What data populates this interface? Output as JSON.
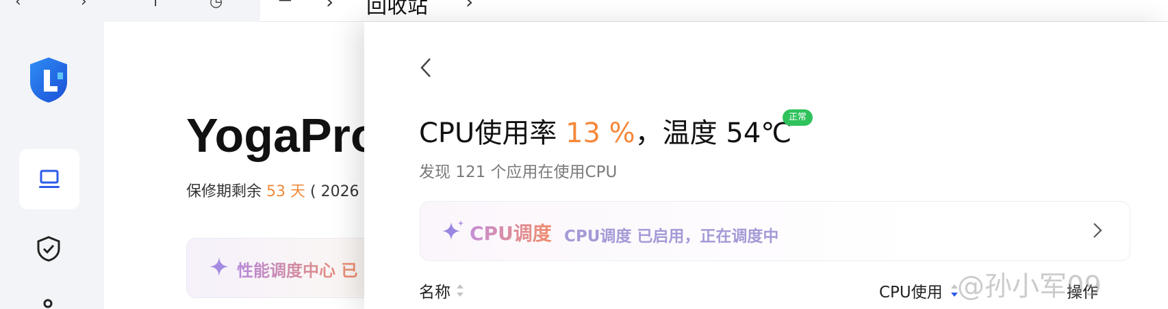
{
  "topbar": {
    "back": "‹",
    "forward": "›",
    "pin": "↑",
    "clock": "◷",
    "crumb_sep": "›",
    "crumb": "回收站",
    "crumb_end": "›"
  },
  "device": {
    "name": "YogaPro",
    "warranty_prefix": "保修期剩余 ",
    "warranty_days": "53 天",
    "warranty_suffix": " ( 2026",
    "perf_label": "性能调度中心 已"
  },
  "panel": {
    "title_prefix": "CPU使用率 ",
    "cpu_usage": "13 %",
    "title_mid": "，温度 54℃",
    "status_badge": "正常",
    "subtitle": "发现 121 个应用在使用CPU",
    "schedule_title": "CPU调度",
    "schedule_desc": "CPU调度 已启用，正在调度中"
  },
  "table": {
    "headers": [
      "名称",
      "CPU使用",
      "操作"
    ]
  },
  "watermark": "@孙小军09",
  "colors": {
    "accent_orange": "#f5883a",
    "status_green": "#2fc25b",
    "brand_blue": "#1d5cf0",
    "nav_active_blue": "#2b5be8"
  }
}
